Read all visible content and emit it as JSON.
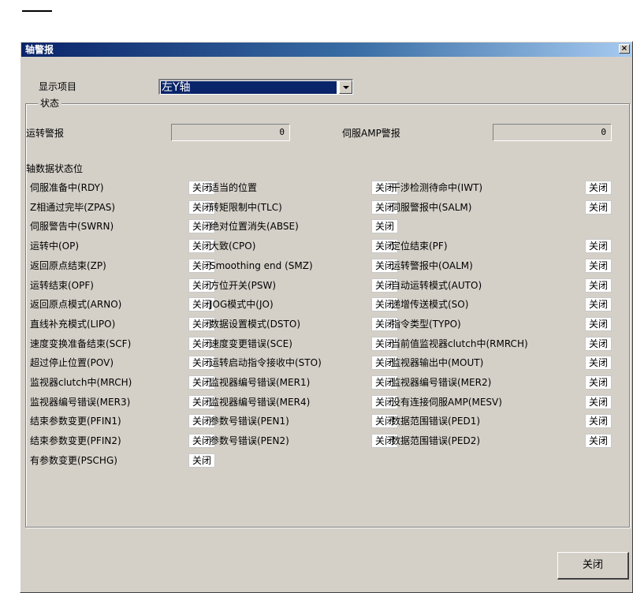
{
  "window": {
    "title": "轴警报",
    "close_glyph": "×"
  },
  "display_item": {
    "label": "显示项目",
    "selected": "左Y轴"
  },
  "status_group": {
    "legend": "状态",
    "run_alarm_label": "运转警报",
    "run_alarm_value": "0",
    "servo_alarm_label": "伺服AMP警报",
    "servo_alarm_value": "0",
    "bits_heading": "轴数据状态位"
  },
  "status_rows": [
    [
      {
        "label": "伺服准备中(RDY)",
        "state": "关闭"
      },
      {
        "label": "适当的位置",
        "state": "关闭"
      },
      {
        "label": "干涉检测待命中(IWT)",
        "state": "关闭"
      }
    ],
    [
      {
        "label": "Z相通过完毕(ZPAS)",
        "state": "关闭"
      },
      {
        "label": "转矩限制中(TLC)",
        "state": "关闭"
      },
      {
        "label": "伺服警报中(SALM)",
        "state": "关闭"
      }
    ],
    [
      {
        "label": "伺服警告中(SWRN)",
        "state": "关闭"
      },
      {
        "label": "绝对位置消失(ABSE)",
        "state": "关闭"
      },
      {
        "label": "",
        "state": ""
      }
    ],
    [
      {
        "label": "运转中(OP)",
        "state": "关闭"
      },
      {
        "label": "大致(CPO)",
        "state": "关闭"
      },
      {
        "label": "定位结束(PF)",
        "state": "关闭"
      }
    ],
    [
      {
        "label": "返回原点结束(ZP)",
        "state": "关闭"
      },
      {
        "label": "Smoothing end (SMZ)",
        "state": "关闭"
      },
      {
        "label": "运转警报中(OALM)",
        "state": "关闭"
      }
    ],
    [
      {
        "label": "运转结束(OPF)",
        "state": "关闭"
      },
      {
        "label": "方位开关(PSW)",
        "state": "关闭"
      },
      {
        "label": "自动运转模式(AUTO)",
        "state": "关闭"
      }
    ],
    [
      {
        "label": "返回原点模式(ARNO)",
        "state": "关闭"
      },
      {
        "label": "JOG模式中(JO)",
        "state": "关闭"
      },
      {
        "label": "递增传送模式(SO)",
        "state": "关闭"
      }
    ],
    [
      {
        "label": "直线补充模式(LIPO)",
        "state": "关闭"
      },
      {
        "label": "数据设置模式(DSTO)",
        "state": "关闭"
      },
      {
        "label": "指令类型(TYPO)",
        "state": "关闭"
      }
    ],
    [
      {
        "label": "速度变换准备结束(SCF)",
        "state": "关闭"
      },
      {
        "label": "速度变更错误(SCE)",
        "state": "关闭"
      },
      {
        "label": "当前值监视器clutch中(RMRCH)",
        "state": "关闭"
      }
    ],
    [
      {
        "label": "超过停止位置(POV)",
        "state": "关闭"
      },
      {
        "label": "运转启动指令接收中(STO)",
        "state": "关闭"
      },
      {
        "label": "监视器输出中(MOUT)",
        "state": "关闭"
      }
    ],
    [
      {
        "label": "监视器clutch中(MRCH)",
        "state": "关闭"
      },
      {
        "label": "监视器编号错误(MER1)",
        "state": "关闭"
      },
      {
        "label": "监视器编号错误(MER2)",
        "state": "关闭"
      }
    ],
    [
      {
        "label": "监视器编号错误(MER3)",
        "state": "关闭"
      },
      {
        "label": "监视器编号错误(MER4)",
        "state": "关闭"
      },
      {
        "label": "没有连接伺服AMP(MESV)",
        "state": "关闭"
      }
    ],
    [
      {
        "label": "结束参数变更(PFIN1)",
        "state": "关闭"
      },
      {
        "label": "参数号错误(PEN1)",
        "state": "关闭"
      },
      {
        "label": "数据范围错误(PED1)",
        "state": "关闭"
      }
    ],
    [
      {
        "label": "结束参数变更(PFIN2)",
        "state": "关闭"
      },
      {
        "label": "参数号错误(PEN2)",
        "state": "关闭"
      },
      {
        "label": "数据范围错误(PED2)",
        "state": "关闭"
      }
    ],
    [
      {
        "label": "有参数变更(PSCHG)",
        "state": "关闭"
      },
      {
        "label": "",
        "state": ""
      },
      {
        "label": "",
        "state": ""
      }
    ]
  ],
  "buttons": {
    "close_label": "关闭"
  }
}
